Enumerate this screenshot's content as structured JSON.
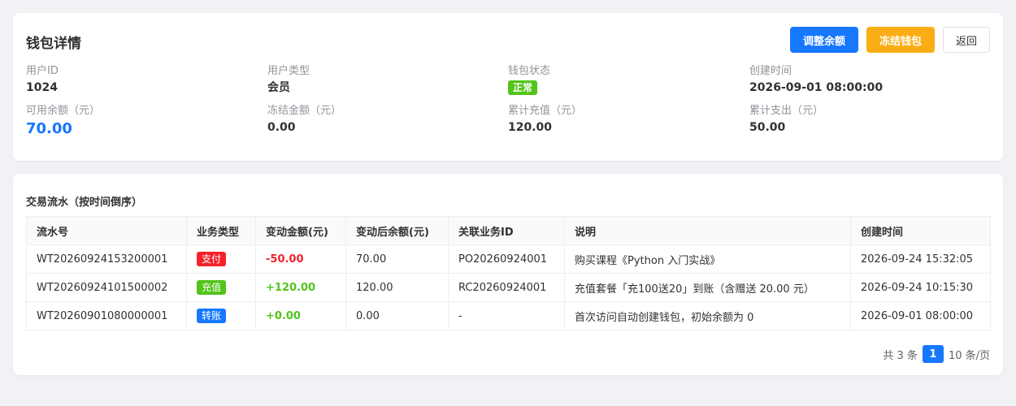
{
  "header": {
    "title": "钱包详情",
    "buttons": {
      "adjust": "调整余额",
      "freeze": "冻结钱包",
      "back": "返回"
    }
  },
  "info": {
    "user_id": {
      "label": "用户ID",
      "value": "1024"
    },
    "user_type": {
      "label": "用户类型",
      "value": "会员"
    },
    "wallet_status": {
      "label": "钱包状态",
      "value": "正常"
    },
    "created_at": {
      "label": "创建时间",
      "value": "2026-09-01 08:00:00"
    },
    "available_balance": {
      "label": "可用余额（元）",
      "value": "70.00"
    },
    "frozen_amount": {
      "label": "冻结金额（元）",
      "value": "0.00"
    },
    "total_recharge": {
      "label": "累计充值（元）",
      "value": "120.00"
    },
    "total_expense": {
      "label": "累计支出（元）",
      "value": "50.00"
    }
  },
  "transactions": {
    "title": "交易流水（按时间倒序）",
    "columns": [
      "流水号",
      "业务类型",
      "变动金额(元)",
      "变动后余额(元)",
      "关联业务ID",
      "说明",
      "创建时间"
    ],
    "rows": [
      {
        "serial": "WT20260924153200001",
        "type": "支付",
        "type_color": "#f5222d",
        "amount": "-50.00",
        "balance": "70.00",
        "ref_id": "PO20260924001",
        "desc": "购买课程《Python 入门实战》",
        "created": "2026-09-24 15:32:05"
      },
      {
        "serial": "WT20260924101500002",
        "type": "充值",
        "type_color": "#52c41a",
        "amount": "+120.00",
        "balance": "120.00",
        "ref_id": "RC20260924001",
        "desc": "充值套餐「充100送20」到账（含赠送 20.00 元）",
        "created": "2026-09-24 10:15:30"
      },
      {
        "serial": "WT20260901080000001",
        "type": "转账",
        "type_color": "#1677ff",
        "amount": "+0.00",
        "balance": "0.00",
        "ref_id": "-",
        "desc": "首次访问自动创建钱包，初始余额为 0",
        "created": "2026-09-01 08:00:00"
      }
    ]
  },
  "pagination": {
    "total_text": "共 3 条",
    "current_page": "1",
    "page_size_text": "10 条/页"
  },
  "colors": {
    "primary": "#1677ff",
    "warning": "#faad14",
    "success": "#52c41a",
    "danger": "#f5222d"
  }
}
